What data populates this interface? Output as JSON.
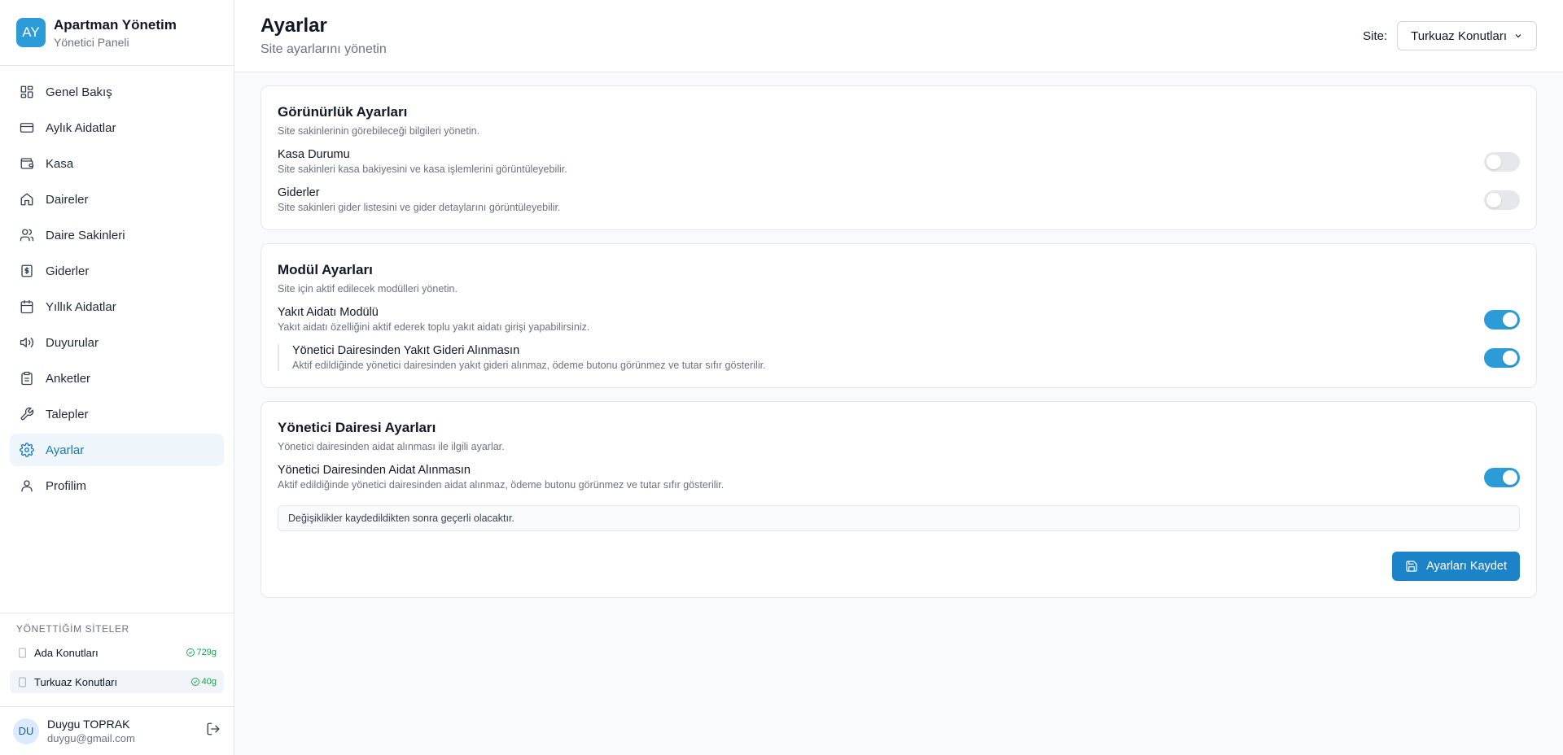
{
  "brand": {
    "logo": "AY",
    "title": "Apartman Yönetim",
    "subtitle": "Yönetici Paneli"
  },
  "nav": [
    {
      "label": "Genel Bakış",
      "icon": "grid-icon"
    },
    {
      "label": "Aylık Aidatlar",
      "icon": "credit-card-icon"
    },
    {
      "label": "Kasa",
      "icon": "wallet-icon"
    },
    {
      "label": "Daireler",
      "icon": "home-icon"
    },
    {
      "label": "Daire Sakinleri",
      "icon": "users-icon"
    },
    {
      "label": "Giderler",
      "icon": "receipt-icon"
    },
    {
      "label": "Yıllık Aidatlar",
      "icon": "calendar-icon"
    },
    {
      "label": "Duyurular",
      "icon": "megaphone-icon"
    },
    {
      "label": "Anketler",
      "icon": "clipboard-icon"
    },
    {
      "label": "Talepler",
      "icon": "wrench-icon"
    },
    {
      "label": "Ayarlar",
      "icon": "gear-icon",
      "active": true
    },
    {
      "label": "Profilim",
      "icon": "user-icon"
    }
  ],
  "sites": {
    "title": "YÖNETTİĞİM SİTELER",
    "items": [
      {
        "name": "Ada Konutları",
        "badge": "729g"
      },
      {
        "name": "Turkuaz Konutları",
        "badge": "40g",
        "active": true
      }
    ]
  },
  "user": {
    "initials": "DU",
    "name": "Duygu TOPRAK",
    "email": "duygu@gmail.com"
  },
  "header": {
    "title": "Ayarlar",
    "subtitle": "Site ayarlarını yönetin",
    "site_label": "Site:",
    "site_value": "Turkuaz Konutları"
  },
  "visibility": {
    "title": "Görünürlük Ayarları",
    "desc": "Site sakinlerinin görebileceği bilgileri yönetin.",
    "items": [
      {
        "label": "Kasa Durumu",
        "desc": "Site sakinleri kasa bakiyesini ve kasa işlemlerini görüntüleyebilir.",
        "on": false
      },
      {
        "label": "Giderler",
        "desc": "Site sakinleri gider listesini ve gider detaylarını görüntüleyebilir.",
        "on": false
      }
    ]
  },
  "modules": {
    "title": "Modül Ayarları",
    "desc": "Site için aktif edilecek modülleri yönetin.",
    "items": [
      {
        "label": "Yakıt Aidatı Modülü",
        "desc": "Yakıt aidatı özelliğini aktif ederek toplu yakıt aidatı girişi yapabilirsiniz.",
        "on": true
      },
      {
        "label": "Yönetici Dairesinden Yakıt Gideri Alınmasın",
        "desc": "Aktif edildiğinde yönetici dairesinden yakıt gideri alınmaz, ödeme butonu görünmez ve tutar sıfır gösterilir.",
        "on": true
      }
    ]
  },
  "manager": {
    "title": "Yönetici Dairesi Ayarları",
    "desc": "Yönetici dairesinden aidat alınması ile ilgili ayarlar.",
    "items": [
      {
        "label": "Yönetici Dairesinden Aidat Alınmasın",
        "desc": "Aktif edildiğinde yönetici dairesinden aidat alınmaz, ödeme butonu görünmez ve tutar sıfır gösterilir.",
        "on": true
      }
    ],
    "notice": "Değişiklikler kaydedildikten sonra geçerli olacaktır.",
    "save_label": "Ayarları Kaydet"
  },
  "colors": {
    "accent": "#2b9cd8",
    "button": "#1d83c8",
    "success": "#16a34a"
  }
}
